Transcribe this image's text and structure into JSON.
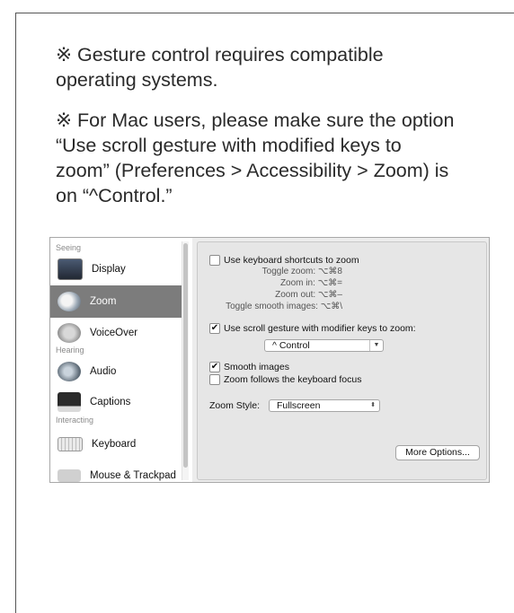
{
  "notes": {
    "gesture": "※ Gesture control requires compatible\noperating systems.",
    "mac": "※ For Mac users, please make sure the option\n  “Use scroll gesture with modified keys to\nzoom”  (Preferences > Accessibility > Zoom) is\non  “^Control.”"
  },
  "sidebar": {
    "sections": [
      "Seeing",
      "Hearing",
      "Interacting"
    ],
    "items": [
      {
        "label": "Display",
        "icon": "display-icon"
      },
      {
        "label": "Zoom",
        "icon": "zoom-icon",
        "selected": true
      },
      {
        "label": "VoiceOver",
        "icon": "voiceover-icon"
      },
      {
        "label": "Audio",
        "icon": "audio-icon"
      },
      {
        "label": "Captions",
        "icon": "captions-icon"
      },
      {
        "label": "Keyboard",
        "icon": "keyboard-icon"
      },
      {
        "label": "Mouse & Trackpad",
        "icon": "mouse-icon"
      }
    ]
  },
  "panel": {
    "keyboard_shortcuts": {
      "label": "Use keyboard shortcuts to zoom",
      "checked": false
    },
    "hints": [
      "Toggle zoom:  ⌥⌘8",
      "Zoom in:  ⌥⌘=",
      "Zoom out:  ⌥⌘–",
      "Toggle smooth images:  ⌥⌘\\"
    ],
    "scroll_gesture": {
      "label": "Use scroll gesture with modifier keys to zoom:",
      "checked": true,
      "checkmark": "✔"
    },
    "modifier_value": "^ Control",
    "smooth_images": {
      "label": "Smooth images",
      "checked": true,
      "checkmark": "✔"
    },
    "follow_focus": {
      "label": "Zoom follows the keyboard focus",
      "checked": false
    },
    "zoom_style_label": "Zoom Style:",
    "zoom_style_value": "Fullscreen",
    "more_options": "More Options..."
  }
}
